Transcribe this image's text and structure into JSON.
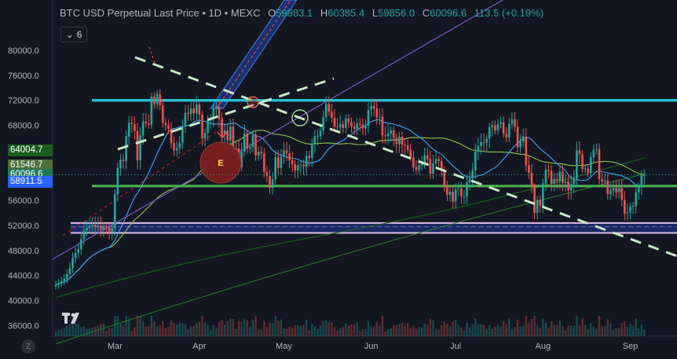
{
  "header": {
    "symbol": "BTC USD Perpetual Last Price • 1D • MEXC",
    "open_label": "O",
    "open": "59983.1",
    "high_label": "H",
    "high": "60385.4",
    "low_label": "L",
    "low": "59856.0",
    "close_label": "C",
    "close": "60096.6",
    "change": "113.5 (+0.19%)",
    "indicator_count": "6"
  },
  "badges": [
    {
      "text": "64004.7",
      "value": 64004.7,
      "color": "#1b5e20"
    },
    {
      "text": "61546.7",
      "value": 61546.7,
      "color": "#4e6e3a"
    },
    {
      "text": "60096.6",
      "value": 60096.6,
      "color": "#1e7a5a"
    },
    {
      "text": "58911.5",
      "value": 58911.5,
      "color": "#2962ff"
    }
  ],
  "zoom_button": "Z",
  "event_marker": "E",
  "chart_data": {
    "type": "candlestick",
    "title": "BTC USD Perpetual Last Price • 1D • MEXC",
    "xlabel": "",
    "ylabel": "",
    "ylim": [
      32000,
      82000
    ],
    "y_ticks": [
      "80000.0",
      "76000.0",
      "72000.0",
      "68000.0",
      "64000.0",
      "60000.0",
      "56000.0",
      "52000.0",
      "48000.0",
      "44000.0",
      "40000.0",
      "36000.0"
    ],
    "y_tick_values": [
      80000,
      76000,
      72000,
      68000,
      64000,
      60000,
      56000,
      52000,
      48000,
      44000,
      40000,
      36000
    ],
    "x_ticks": [
      "Mar",
      "Apr",
      "May",
      "Jun",
      "Jul",
      "Aug",
      "Sep"
    ],
    "x_tick_day_index": [
      21,
      51,
      81,
      112,
      142,
      173,
      204
    ],
    "close_series": [
      42500,
      42800,
      43100,
      43500,
      44200,
      45200,
      46800,
      47600,
      48200,
      49800,
      51200,
      51600,
      51800,
      52100,
      51700,
      52000,
      51300,
      51900,
      51700,
      50900,
      51600,
      57000,
      61200,
      62500,
      62300,
      66200,
      68400,
      68200,
      67100,
      62400,
      66400,
      68600,
      68300,
      68100,
      72600,
      71400,
      73000,
      71200,
      68400,
      68000,
      67500,
      65200,
      64000,
      64400,
      65200,
      67800,
      70000,
      69800,
      70700,
      69900,
      71300,
      69700,
      65900,
      66800,
      68800,
      69000,
      70600,
      71000,
      69000,
      66600,
      67200,
      65600,
      67800,
      63800,
      64300,
      61400,
      63800,
      66700,
      64300,
      64500,
      66500,
      63200,
      63800,
      63500,
      60600,
      59900,
      58000,
      59400,
      62900,
      61200,
      63000,
      64000,
      63500,
      62400,
      61800,
      60800,
      61600,
      61700,
      61400,
      63100,
      62800,
      65000,
      66300,
      66300,
      67200,
      69300,
      71400,
      70200,
      69200,
      67800,
      67700,
      68200,
      67600,
      69100,
      68500,
      67800,
      67400,
      68300,
      68100,
      67500,
      67900,
      70500,
      71100,
      70700,
      69300,
      69400,
      66400,
      66300,
      66700,
      67200,
      66000,
      65000,
      66200,
      64900,
      64800,
      64100,
      62900,
      61300,
      60900,
      61600,
      61900,
      63200,
      62600,
      60300,
      61900,
      62600,
      62300,
      60800,
      58400,
      56900,
      57400,
      55800,
      57800,
      57900,
      56600,
      56600,
      58900,
      59500,
      60800,
      63800,
      64700,
      65300,
      65200,
      65900,
      67700,
      68000,
      67200,
      68200,
      68500,
      66700,
      66100,
      68200,
      69000,
      67800,
      64500,
      65400,
      66200,
      61600,
      60400,
      58100,
      54000,
      56100,
      55100,
      58700,
      60900,
      60700,
      58700,
      59400,
      59100,
      60600,
      58800,
      59000,
      57600,
      58600,
      59500,
      64000,
      63400,
      61000,
      61100,
      60400,
      62900,
      64100,
      64200,
      59400,
      59000,
      59200,
      57000,
      57600,
      58000,
      57300,
      58000,
      56100,
      53900,
      54100,
      55000,
      55100,
      57300,
      58100,
      60000,
      60100
    ],
    "sma_blue": {
      "name": "",
      "value": 58911.5
    },
    "sma_green": {
      "name": "",
      "value": 61546.7
    },
    "sma_dark_green": {
      "name": "",
      "value": 64004.7
    },
    "last_price": 60096.6,
    "horizontal_levels": [
      {
        "price": 72000,
        "color": "#26c6da"
      },
      {
        "price": 58300,
        "color": "#4caf50"
      }
    ],
    "range_band": {
      "top": 52400,
      "bottom": 50800,
      "mid": 51800,
      "color": "#1e2d6b"
    },
    "grid": false,
    "legend": "top-left"
  }
}
